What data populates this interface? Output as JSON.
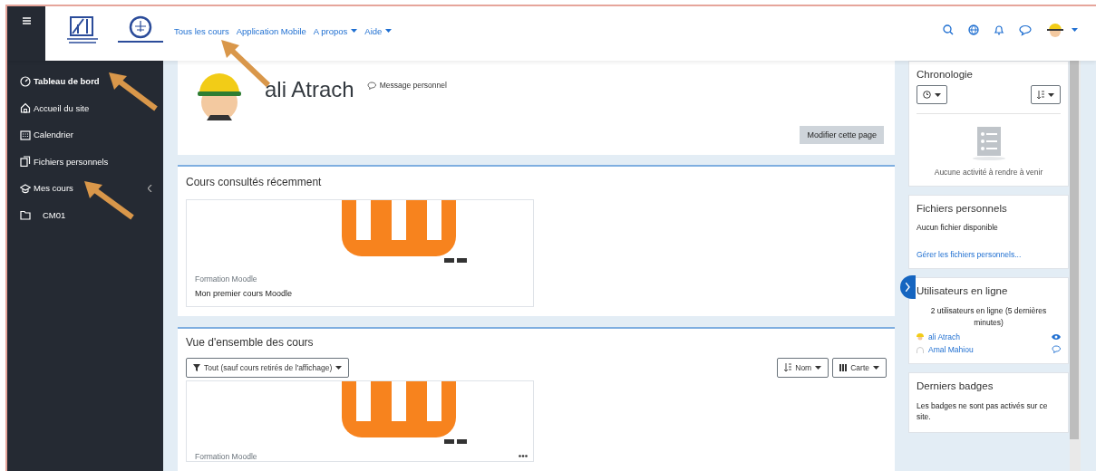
{
  "navbar": {
    "links": [
      {
        "label": "Tous les cours",
        "dropdown": false
      },
      {
        "label": "Application Mobile",
        "dropdown": false
      },
      {
        "label": "A propos",
        "dropdown": true
      },
      {
        "label": "Aide",
        "dropdown": true
      }
    ]
  },
  "sidebar": {
    "items": [
      {
        "label": "Tableau de bord",
        "selected": true
      },
      {
        "label": "Accueil du site",
        "selected": false
      },
      {
        "label": "Calendrier",
        "selected": false
      },
      {
        "label": "Fichiers personnels",
        "selected": false
      },
      {
        "label": "Mes cours",
        "selected": false,
        "children": [
          {
            "label": "CM01",
            "selected": false
          }
        ]
      }
    ]
  },
  "profile": {
    "name": "ali Atrach",
    "message_link": "Message personnel",
    "edit_button": "Modifier cette page"
  },
  "recent_courses": {
    "title": "Cours consultés récemment",
    "courses": [
      {
        "category": "Formation Moodle",
        "name": "Mon premier cours Moodle"
      }
    ]
  },
  "course_overview": {
    "title": "Vue d'ensemble des cours",
    "filter": "Tout (sauf cours retirés de l'affichage)",
    "sort": "Nom",
    "view": "Carte",
    "courses": [
      {
        "category": "Formation Moodle"
      }
    ]
  },
  "blocks": [
    {
      "kind": "timeline",
      "title": "Chronologie",
      "text": "Aucune activité à rendre à venir"
    },
    {
      "kind": "files",
      "title": "Fichiers personnels",
      "text": "Aucun fichier disponible",
      "link": "Gérer les fichiers personnels..."
    },
    {
      "kind": "online",
      "title": "Utilisateurs en ligne",
      "text": "2 utilisateurs en ligne (5 dernières minutes)",
      "users": [
        {
          "name": "ali Atrach",
          "kind": "self"
        },
        {
          "name": "Amal Mahiou",
          "kind": "other"
        }
      ]
    },
    {
      "kind": "text",
      "title": "Derniers badges",
      "text": "Les badges ne sont pas activés sur ce site."
    }
  ]
}
